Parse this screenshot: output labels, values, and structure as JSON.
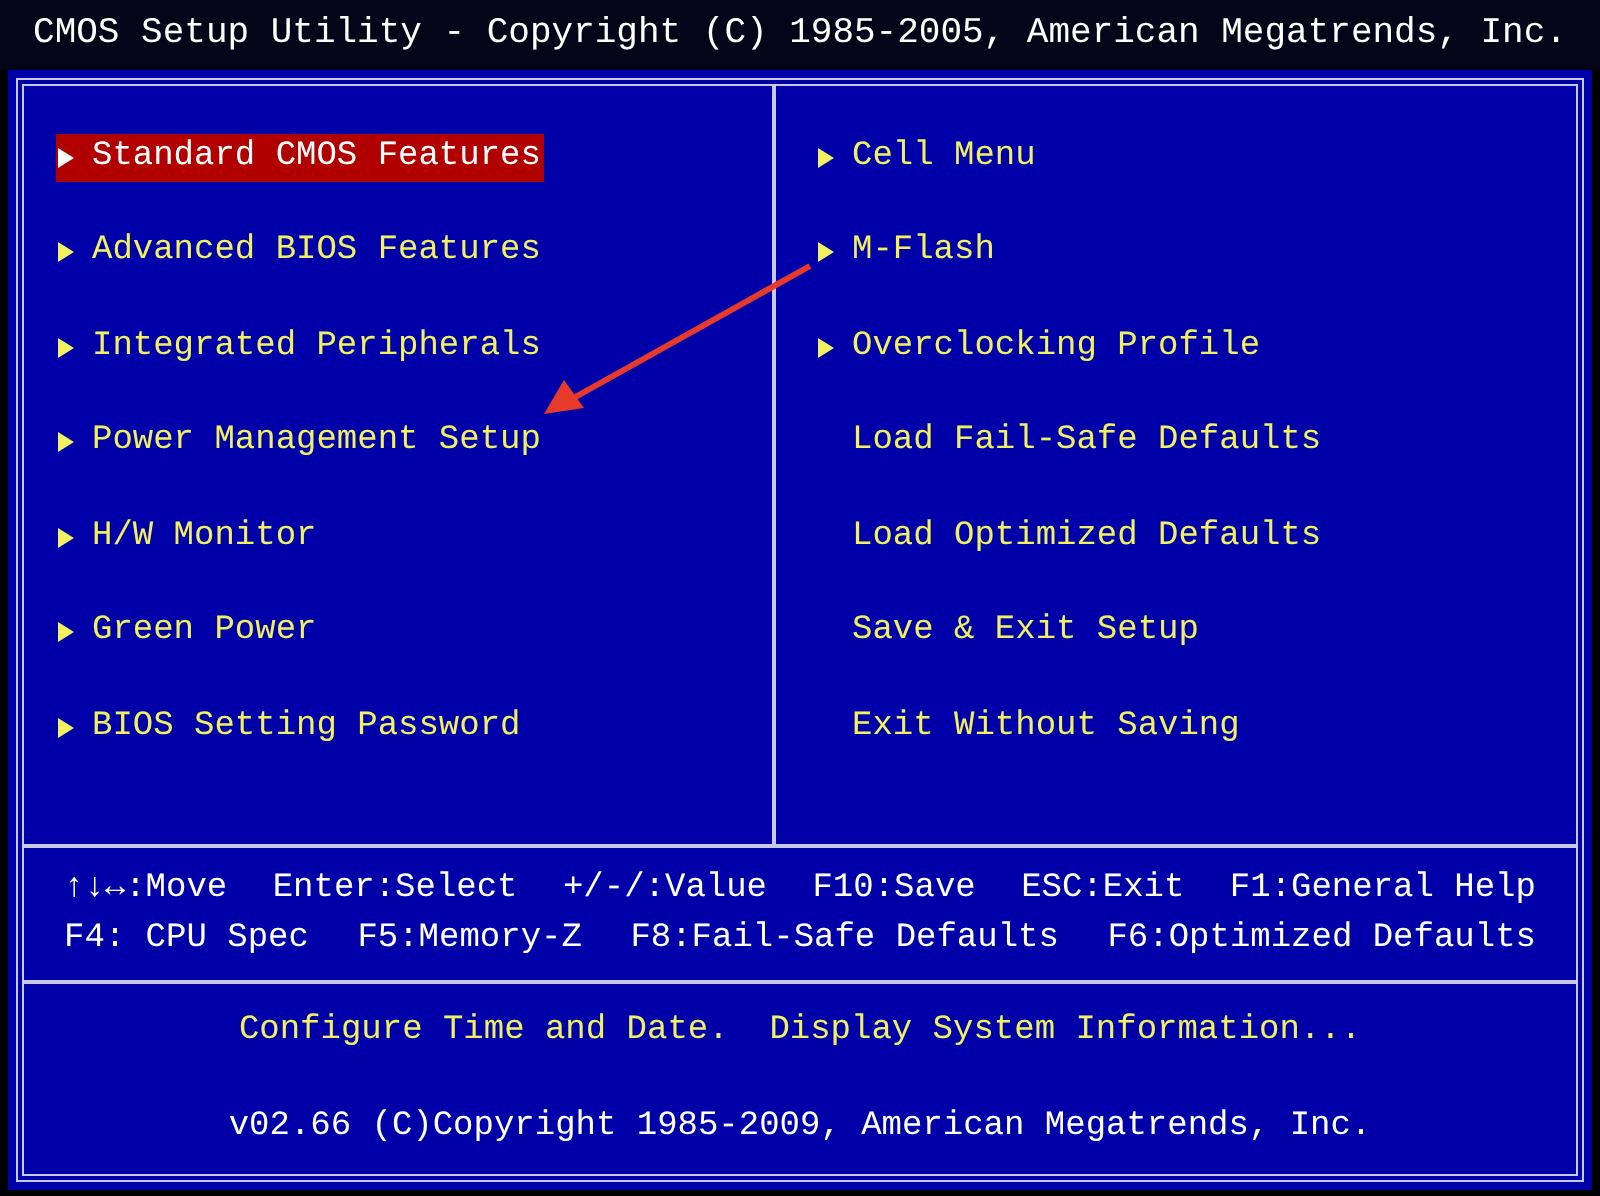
{
  "title": "CMOS Setup Utility - Copyright (C) 1985-2005, American Megatrends, Inc.",
  "menu_columns": [
    [
      {
        "label": "Standard CMOS Features",
        "kind": "submenu",
        "selected": true
      },
      {
        "label": "Advanced BIOS Features",
        "kind": "submenu",
        "selected": false
      },
      {
        "label": "Integrated Peripherals",
        "kind": "submenu",
        "selected": false
      },
      {
        "label": "Power Management Setup",
        "kind": "submenu",
        "selected": false
      },
      {
        "label": "H/W Monitor",
        "kind": "submenu",
        "selected": false
      },
      {
        "label": "Green Power",
        "kind": "submenu",
        "selected": false
      },
      {
        "label": "BIOS Setting Password",
        "kind": "submenu",
        "selected": false
      }
    ],
    [
      {
        "label": "Cell Menu",
        "kind": "submenu",
        "selected": false
      },
      {
        "label": "M-Flash",
        "kind": "submenu",
        "selected": false
      },
      {
        "label": "Overclocking Profile",
        "kind": "submenu",
        "selected": false
      },
      {
        "label": "Load Fail-Safe Defaults",
        "kind": "action",
        "selected": false
      },
      {
        "label": "Load Optimized Defaults",
        "kind": "action",
        "selected": false
      },
      {
        "label": "Save & Exit Setup",
        "kind": "action",
        "selected": false
      },
      {
        "label": "Exit Without Saving",
        "kind": "action",
        "selected": false
      }
    ]
  ],
  "help_lines": [
    [
      "↑↓↔:Move",
      "Enter:Select",
      "+/-/:Value",
      "F10:Save",
      "ESC:Exit",
      "F1:General Help"
    ],
    [
      "F4: CPU Spec",
      "F5:Memory-Z",
      "F8:Fail-Safe Defaults",
      "F6:Optimized Defaults"
    ]
  ],
  "description": "Configure Time and Date.  Display System Information...",
  "footer": "v02.66 (C)Copyright 1985-2009, American Megatrends, Inc."
}
